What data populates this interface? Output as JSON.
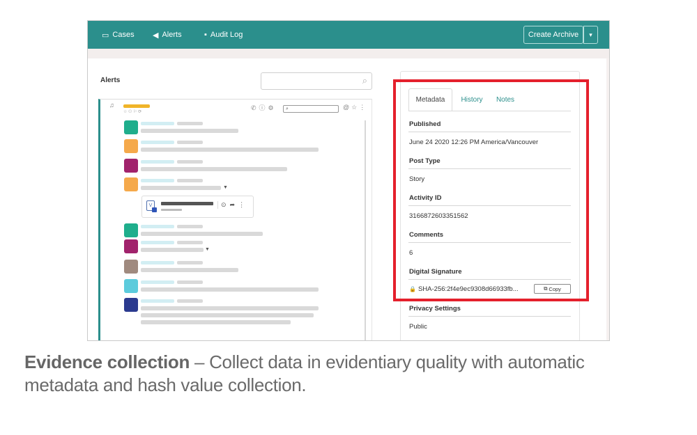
{
  "nav": {
    "cases_label": "Cases",
    "alerts_label": "Alerts",
    "audit_log_label": "Audit Log",
    "create_archive_label": "Create Archive"
  },
  "alerts_panel": {
    "title": "Alerts",
    "search_value": "",
    "tag_color": "#f0b429",
    "row_avatar_colors": [
      "#1fae8c",
      "#f5a94b",
      "#a1236c",
      "#f5a94b",
      "#1fae8c",
      "#a1236c",
      "#a08a7f",
      "#5ccbdc",
      "#2b3a8f"
    ]
  },
  "metadata_panel": {
    "tabs": [
      {
        "label": "Metadata",
        "active": true
      },
      {
        "label": "History",
        "active": false
      },
      {
        "label": "Notes",
        "active": false
      }
    ],
    "fields": {
      "published_label": "Published",
      "published_value": "June 24 2020 12:26 PM America/Vancouver",
      "post_type_label": "Post Type",
      "post_type_value": "Story",
      "activity_id_label": "Activity ID",
      "activity_id_value": "3166872603351562",
      "comments_label": "Comments",
      "comments_value": "6",
      "digital_signature_label": "Digital Signature",
      "digital_signature_value": "SHA-256:2f4e9ec9308d66933fb...",
      "copy_label": "Copy",
      "privacy_settings_label": "Privacy Settings",
      "privacy_settings_value": "Public"
    },
    "highlight_color": "#e4202c"
  },
  "caption": {
    "bold": "Evidence collection",
    "text": " – Collect data in evidentiary quality with automatic metadata and hash value collection."
  },
  "colors": {
    "brand": "#2b8f8c"
  }
}
